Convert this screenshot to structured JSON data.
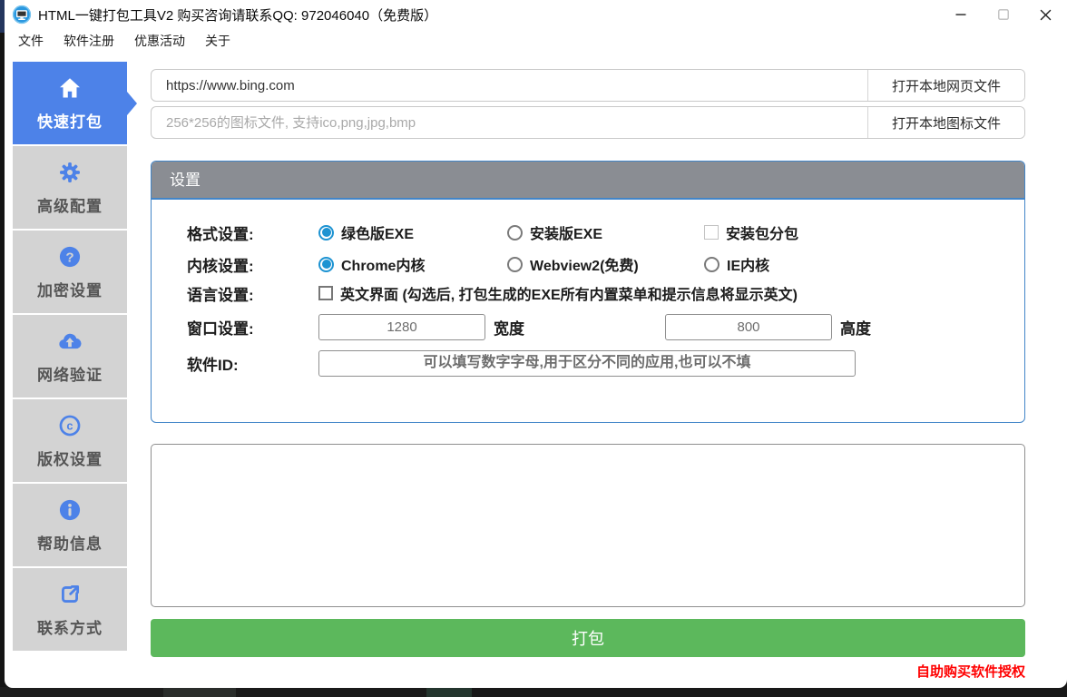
{
  "colors": {
    "accent_blue": "#4d82e8",
    "panel_border_blue": "#4285c8",
    "panel_header_gray": "#8a8d93",
    "pack_green": "#5cb85c",
    "link_red": "#ff0000",
    "radio_blue": "#1d93d2"
  },
  "titlebar": {
    "title": "HTML一键打包工具V2 购买咨询请联系QQ: 972046040（免费版）"
  },
  "menubar": {
    "items": [
      "文件",
      "软件注册",
      "优惠活动",
      "关于"
    ]
  },
  "sidebar": {
    "items": [
      {
        "label": "快速打包",
        "icon": "home-icon",
        "active": true
      },
      {
        "label": "高级配置",
        "icon": "gear-icon",
        "active": false
      },
      {
        "label": "加密设置",
        "icon": "question-circle-icon",
        "active": false
      },
      {
        "label": "网络验证",
        "icon": "cloud-upload-icon",
        "active": false
      },
      {
        "label": "版权设置",
        "icon": "copyright-icon",
        "active": false
      },
      {
        "label": "帮助信息",
        "icon": "info-circle-icon",
        "active": false
      },
      {
        "label": "联系方式",
        "icon": "share-icon",
        "active": false
      }
    ]
  },
  "source": {
    "url_value": "https://www.bing.com",
    "open_web_button": "打开本地网页文件",
    "icon_placeholder": "256*256的图标文件, 支持ico,png,jpg,bmp",
    "open_icon_button": "打开本地图标文件"
  },
  "settings": {
    "title": "设置",
    "format_row": {
      "label": "格式设置:",
      "options": [
        {
          "label": "绿色版EXE",
          "selected": true
        },
        {
          "label": "安装版EXE",
          "selected": false
        }
      ],
      "split_package": {
        "label": "安装包分包",
        "checked": false
      }
    },
    "kernel_row": {
      "label": "内核设置:",
      "options": [
        {
          "label": "Chrome内核",
          "selected": true
        },
        {
          "label": "Webview2(免费)",
          "selected": false
        },
        {
          "label": "IE内核",
          "selected": false
        }
      ]
    },
    "language_row": {
      "label": "语言设置:",
      "english_checkbox": {
        "label": "英文界面 (勾选后, 打包生成的EXE所有内置菜单和提示信息将显示英文)",
        "checked": false
      }
    },
    "window_row": {
      "label": "窗口设置:",
      "width_value": "1280",
      "width_unit": "宽度",
      "height_value": "800",
      "height_unit": "高度"
    },
    "appid_row": {
      "label": "软件ID:",
      "placeholder": "可以填写数字字母,用于区分不同的应用,也可以不填"
    }
  },
  "log": {
    "value": ""
  },
  "actions": {
    "pack_button": "打包",
    "buy_license_link": "自助购买软件授权"
  }
}
